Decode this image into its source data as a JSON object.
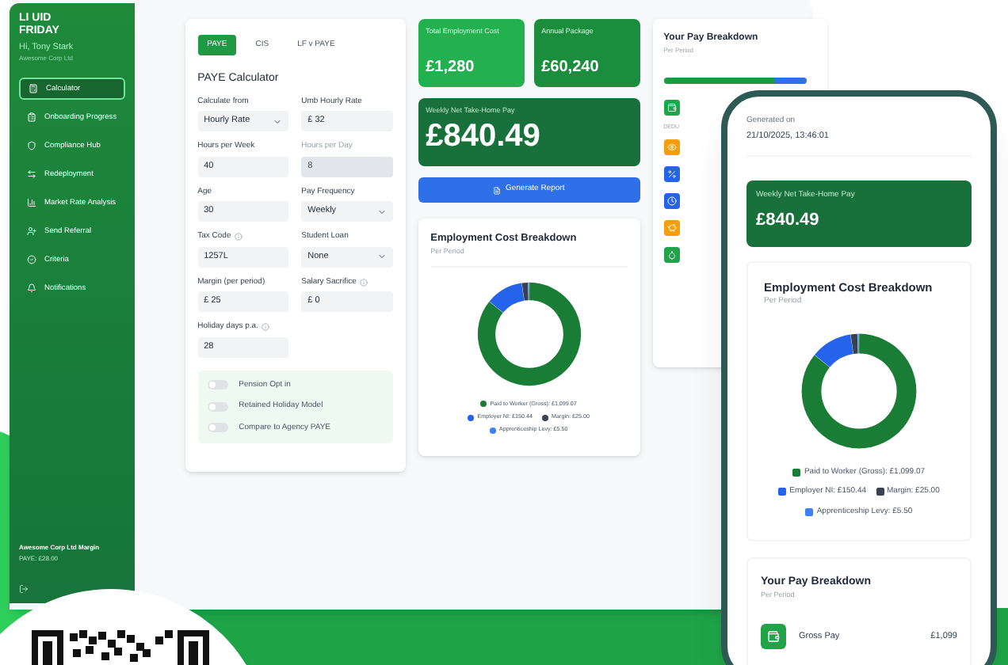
{
  "sidebar": {
    "logo": [
      "LI UID",
      "FRIDAY"
    ],
    "greeting": "Hi, Tony Stark",
    "company": "Awesome Corp Ltd",
    "items": [
      {
        "label": "Calculator",
        "selected": true
      },
      {
        "label": "Onboarding Progress",
        "selected": false
      },
      {
        "label": "Compliance Hub",
        "selected": false
      },
      {
        "label": "Redeployment",
        "selected": false
      },
      {
        "label": "Market Rate Analysis",
        "selected": false
      },
      {
        "label": "Send Referral",
        "selected": false
      },
      {
        "label": "Criteria",
        "selected": false
      },
      {
        "label": "Notifications",
        "selected": false
      }
    ],
    "footer": {
      "title": "Awesome Corp Ltd Margin",
      "value": "PAYE: £28.00"
    }
  },
  "calculator": {
    "tabs": [
      {
        "label": "PAYE",
        "selected": true
      },
      {
        "label": "CIS",
        "selected": false
      },
      {
        "label": "LF v PAYE",
        "selected": false
      }
    ],
    "title": "PAYE Calculator",
    "fields": [
      {
        "label": "Calculate from",
        "value": "Hourly Rate",
        "kind": "select",
        "disabled": false,
        "info": false
      },
      {
        "label": "Umb Hourly Rate",
        "value": "£ 32",
        "kind": "input",
        "disabled": false,
        "info": false
      },
      {
        "label": "Hours per Week",
        "value": "40",
        "kind": "input",
        "disabled": false,
        "info": false
      },
      {
        "label": "Hours per Day",
        "value": "8",
        "kind": "input",
        "disabled": true,
        "info": false
      },
      {
        "label": "Age",
        "value": "30",
        "kind": "input",
        "disabled": false,
        "info": false
      },
      {
        "label": "Pay Frequency",
        "value": "Weekly",
        "kind": "select",
        "disabled": false,
        "info": false
      },
      {
        "label": "Tax Code",
        "value": "1257L",
        "kind": "input",
        "disabled": false,
        "info": true
      },
      {
        "label": "Student Loan",
        "value": "None",
        "kind": "select",
        "disabled": false,
        "info": false
      },
      {
        "label": "Margin (per period)",
        "value": "£ 25",
        "kind": "input",
        "disabled": false,
        "info": false
      },
      {
        "label": "Salary Sacrifice",
        "value": "£ 0",
        "kind": "input",
        "disabled": false,
        "info": true
      },
      {
        "label": "Holiday days p.a.",
        "value": "28",
        "kind": "input",
        "disabled": false,
        "info": true
      }
    ],
    "toggles": [
      {
        "label": "Pension Opt in",
        "on": false
      },
      {
        "label": "Retained Holiday Model",
        "on": false
      },
      {
        "label": "Compare to Agency PAYE",
        "on": false
      }
    ]
  },
  "summary": {
    "cards": [
      {
        "label": "Total Employment Cost",
        "value": "£1,280"
      },
      {
        "label": "Annual Package",
        "value": "£60,240"
      }
    ],
    "net_pay": {
      "label": "Weekly Net Take-Home Pay",
      "value": "£840.49"
    },
    "report_button": "Generate Report"
  },
  "cost_breakdown": {
    "title": "Employment Cost Breakdown",
    "subtitle": "Per Period",
    "chart_data": {
      "type": "donut",
      "values": [
        85.87,
        11.75,
        1.95,
        0.43
      ]
    },
    "legend": [
      {
        "label": "Paid to Worker (Gross): £1,099.07",
        "color": "#1a7d36"
      },
      {
        "label": "Employer NI: £150.44",
        "color": "#2563eb"
      },
      {
        "label": "Margin: £25.00",
        "color": "#374151"
      },
      {
        "label": "Apprenticeship Levy: £5.50",
        "color": "#3b82f6"
      }
    ]
  },
  "pay_breakdown": {
    "title": "Your Pay Breakdown",
    "subtitle": "Per Period",
    "section_label": "DEDU"
  },
  "phone": {
    "generated_label": "Generated on",
    "generated_at": "21/10/2025, 13:46:01",
    "net_pay": {
      "label": "Weekly Net Take-Home Pay",
      "value": "£840.49"
    },
    "cost_breakdown": {
      "title": "Employment Cost Breakdown",
      "subtitle": "Per Period",
      "chart_data": {
        "type": "donut",
        "values": [
          85.87,
          11.75,
          1.95,
          0.43
        ]
      },
      "legend": [
        {
          "label": "Paid to Worker (Gross): £1,099.07",
          "color": "#1a7d36"
        },
        {
          "label": "Employer NI: £150.44",
          "color": "#2563eb"
        },
        {
          "label": "Margin: £25.00",
          "color": "#374151"
        },
        {
          "label": "Apprenticeship Levy: £5.50",
          "color": "#3b82f6"
        }
      ]
    },
    "pay_breakdown": {
      "title": "Your Pay Breakdown",
      "subtitle": "Per Period",
      "rows": [
        {
          "label": "Gross Pay",
          "value": "£1,099"
        }
      ]
    }
  }
}
